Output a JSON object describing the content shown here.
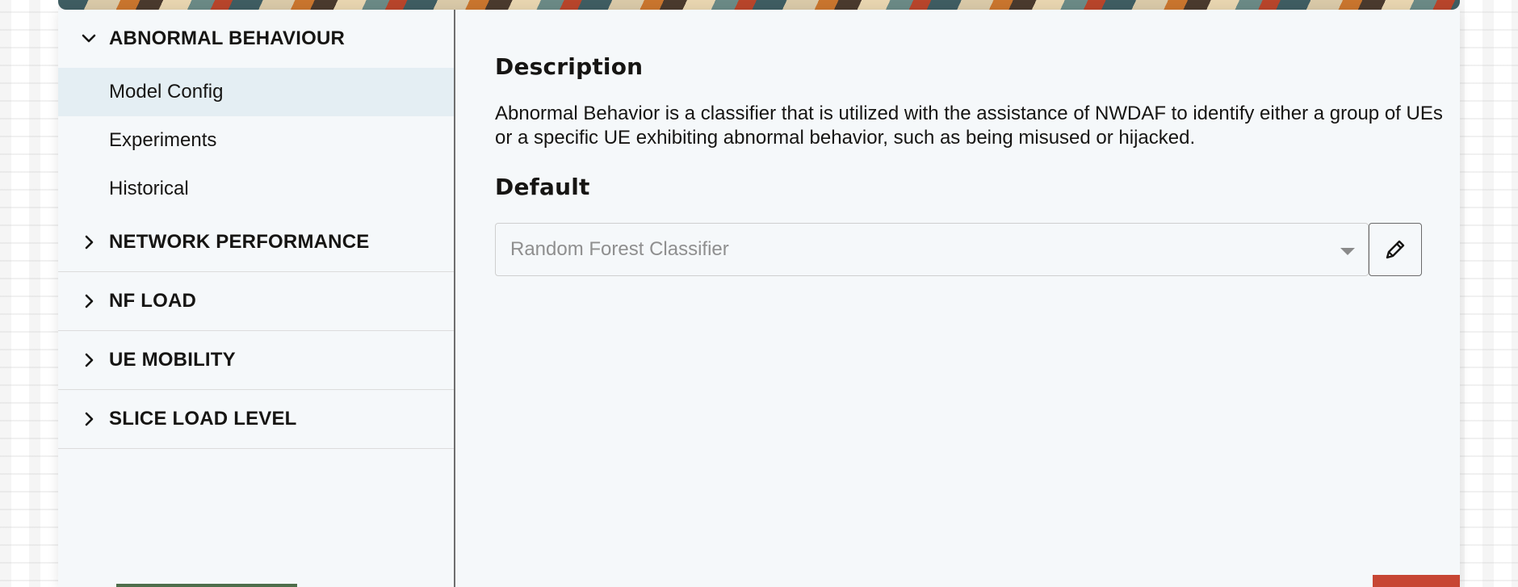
{
  "sidebar": {
    "groups": [
      {
        "title": "ABNORMAL BEHAVIOUR",
        "expanded": true,
        "items": [
          {
            "label": "Model Config",
            "selected": true
          },
          {
            "label": "Experiments",
            "selected": false
          },
          {
            "label": "Historical",
            "selected": false
          }
        ]
      },
      {
        "title": "NETWORK PERFORMANCE",
        "expanded": false
      },
      {
        "title": "NF LOAD",
        "expanded": false
      },
      {
        "title": "UE MOBILITY",
        "expanded": false
      },
      {
        "title": "SLICE LOAD LEVEL",
        "expanded": false
      }
    ]
  },
  "main": {
    "description_heading": "Description",
    "description_text": "Abnormal Behavior is a classifier that is utilized with the assistance of NWDAF to identify either a group of UEs or a specific UE exhibiting abnormal behavior, such as being misused or hijacked.",
    "default_heading": "Default",
    "default_select": {
      "value": "Random Forest Classifier",
      "disabled": true
    },
    "icons": {
      "edit": "pencil-icon",
      "dropdown": "caret-down-icon",
      "expanded": "chevron-down-icon",
      "collapsed": "chevron-right-icon"
    }
  },
  "colors": {
    "selected_item_bg": "#e4eef3",
    "card_bg": "#f5f8fa",
    "accent_red": "#c74634",
    "accent_green": "#4e6e4b"
  }
}
